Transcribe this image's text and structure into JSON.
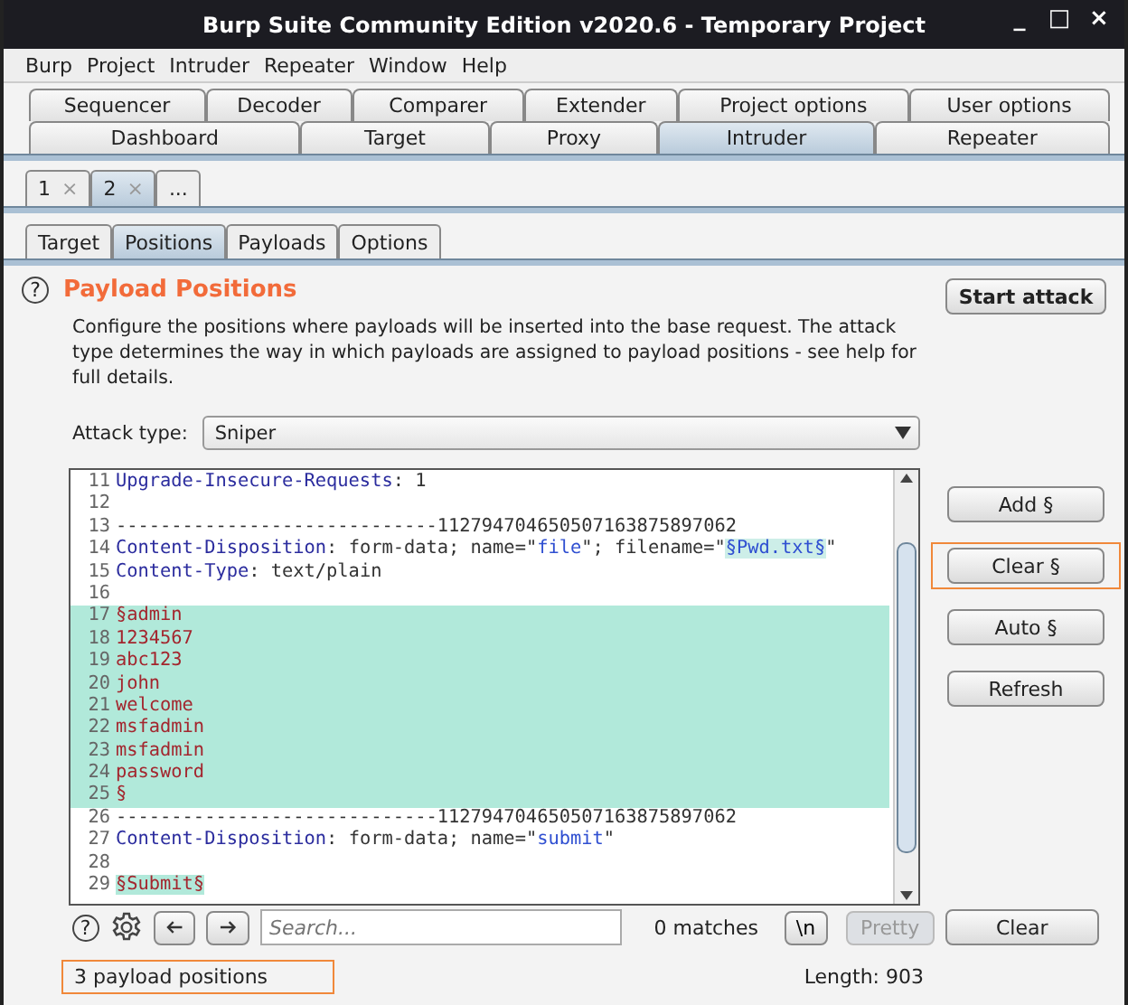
{
  "window": {
    "title": "Burp Suite Community Edition v2020.6 - Temporary Project",
    "controls": [
      "_",
      "□",
      "×"
    ]
  },
  "menu": [
    "Burp",
    "Project",
    "Intruder",
    "Repeater",
    "Window",
    "Help"
  ],
  "tool_tabs": [
    [
      {
        "label": "Sequencer",
        "selected": false
      },
      {
        "label": "Decoder",
        "selected": false
      },
      {
        "label": "Comparer",
        "selected": false
      },
      {
        "label": "Extender",
        "selected": false
      },
      {
        "label": "Project options",
        "selected": false
      },
      {
        "label": "User options",
        "selected": false
      }
    ],
    [
      {
        "label": "Dashboard",
        "selected": false
      },
      {
        "label": "Target",
        "selected": false
      },
      {
        "label": "Proxy",
        "selected": false
      },
      {
        "label": "Intruder",
        "selected": true
      },
      {
        "label": "Repeater",
        "selected": false
      }
    ]
  ],
  "attack_tabs": [
    {
      "label": "1",
      "close": "×",
      "selected": false
    },
    {
      "label": "2",
      "close": "×",
      "selected": true
    },
    {
      "label": "...",
      "selected": false
    }
  ],
  "sub_tabs": [
    {
      "label": "Target",
      "selected": false
    },
    {
      "label": "Positions",
      "selected": true
    },
    {
      "label": "Payloads",
      "selected": false
    },
    {
      "label": "Options",
      "selected": false
    }
  ],
  "section": {
    "help": "?",
    "title": "Payload Positions",
    "description": "Configure the positions where payloads will be inserted into the base request. The attack type determines the way in which payloads are assigned to payload positions - see help for full details.",
    "start_button": "Start attack"
  },
  "attack_type": {
    "label": "Attack type:",
    "value": "Sniper"
  },
  "editor": {
    "lines": [
      {
        "number": "11",
        "highlight": false,
        "segments": [
          {
            "kind": "name",
            "text": "Upgrade-Insecure-Requests"
          },
          {
            "kind": "plain",
            "text": ": 1"
          }
        ]
      },
      {
        "number": "12",
        "highlight": false
      },
      {
        "number": "13",
        "highlight": false,
        "segments": [
          {
            "kind": "plain",
            "text": "-----------------------------112794704650507163875897062"
          }
        ]
      },
      {
        "number": "14",
        "highlight": false,
        "segments": [
          {
            "kind": "name",
            "text": "Content-Disposition"
          },
          {
            "kind": "plain",
            "text": ": form-data; name=\""
          },
          {
            "kind": "string",
            "text": "file"
          },
          {
            "kind": "plain",
            "text": "\"; filename=\""
          },
          {
            "kind": "marked",
            "text": "§Pwd.txt§"
          },
          {
            "kind": "plain",
            "text": "\""
          }
        ]
      },
      {
        "number": "15",
        "highlight": false,
        "segments": [
          {
            "kind": "name",
            "text": "Content-Type"
          },
          {
            "kind": "plain",
            "text": ": text/plain"
          }
        ]
      },
      {
        "number": "16",
        "highlight": false
      },
      {
        "number": "17",
        "highlight": true,
        "segments": [
          {
            "kind": "payload",
            "text": "§admin"
          }
        ]
      },
      {
        "number": "18",
        "highlight": true,
        "segments": [
          {
            "kind": "payload",
            "text": "1234567"
          }
        ]
      },
      {
        "number": "19",
        "highlight": true,
        "segments": [
          {
            "kind": "payload",
            "text": "abc123"
          }
        ]
      },
      {
        "number": "20",
        "highlight": true,
        "segments": [
          {
            "kind": "payload",
            "text": "john"
          }
        ]
      },
      {
        "number": "21",
        "highlight": true,
        "segments": [
          {
            "kind": "payload",
            "text": "welcome"
          }
        ]
      },
      {
        "number": "22",
        "highlight": true,
        "segments": [
          {
            "kind": "payload",
            "text": "msfadmin"
          }
        ]
      },
      {
        "number": "23",
        "highlight": true,
        "segments": [
          {
            "kind": "payload",
            "text": "msfadmin"
          }
        ]
      },
      {
        "number": "24",
        "highlight": true,
        "segments": [
          {
            "kind": "payload",
            "text": "password"
          }
        ]
      },
      {
        "number": "25",
        "highlight": true,
        "segments": [
          {
            "kind": "payload",
            "text": "§"
          }
        ]
      },
      {
        "number": "26",
        "highlight": false,
        "segments": [
          {
            "kind": "plain",
            "text": "-----------------------------112794704650507163875897062"
          }
        ]
      },
      {
        "number": "27",
        "highlight": false,
        "segments": [
          {
            "kind": "name",
            "text": "Content-Disposition"
          },
          {
            "kind": "plain",
            "text": ": form-data; name=\""
          },
          {
            "kind": "string",
            "text": "submit"
          },
          {
            "kind": "plain",
            "text": "\""
          }
        ]
      },
      {
        "number": "28",
        "highlight": false
      },
      {
        "number": "29",
        "highlight": false,
        "segments": [
          {
            "kind": "payload-marked",
            "text": "§Submit§"
          }
        ]
      }
    ]
  },
  "side_buttons": [
    {
      "label": "Add §",
      "highlighted": false
    },
    {
      "label": "Clear §",
      "highlighted": true
    },
    {
      "label": "Auto §",
      "highlighted": false
    },
    {
      "label": "Refresh",
      "highlighted": false
    }
  ],
  "search": {
    "placeholder": "Search...",
    "matches": "0 matches",
    "newline_button": "\\n",
    "pretty_button": {
      "label": "Pretty",
      "disabled": true
    },
    "clear_button": "Clear"
  },
  "status": {
    "positions": "3 payload positions",
    "positions_highlighted": true,
    "length": "Length: 903"
  }
}
